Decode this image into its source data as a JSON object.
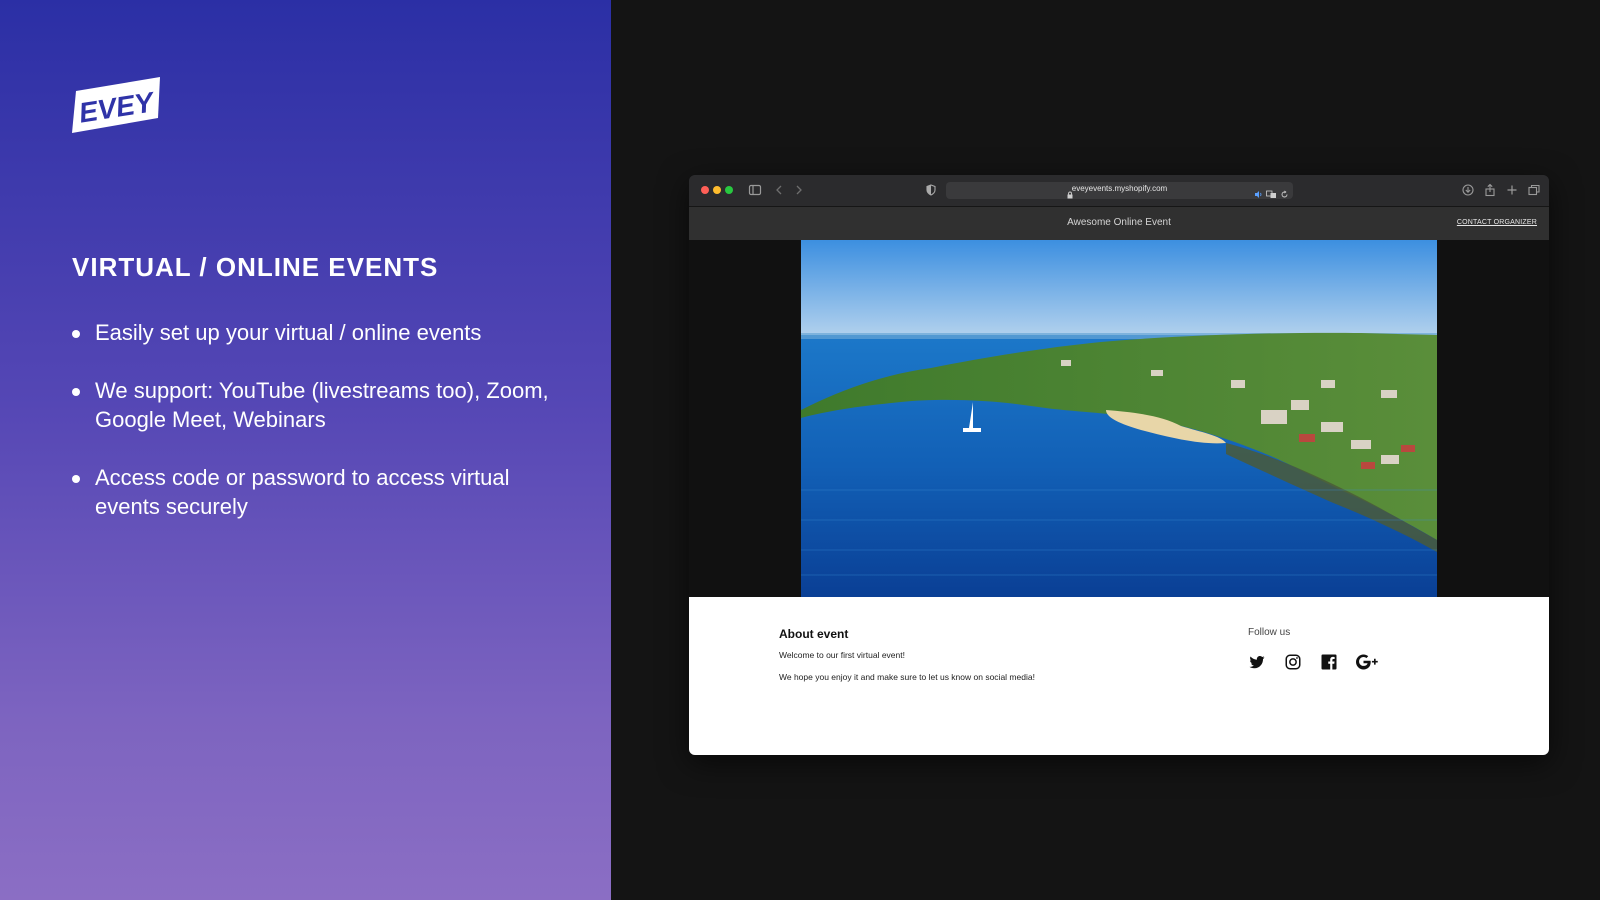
{
  "brand": {
    "logo_text": "EVEY"
  },
  "promo": {
    "title": "VIRTUAL / ONLINE EVENTS",
    "features": [
      "Easily set up your virtual / online events",
      "We support: YouTube (livestreams too), Zoom, Google Meet, Webinars",
      "Access code or password to access virtual events securely"
    ]
  },
  "browser": {
    "url": "eveyevents.myshopify.com",
    "site": {
      "title": "Awesome Online Event",
      "contact_label": "CONTACT ORGANIZER",
      "about": {
        "title": "About event",
        "lines": [
          "Welcome to our first virtual event!",
          "We hope you enjoy it and make sure to let us know on social media!"
        ]
      },
      "follow": {
        "title": "Follow us",
        "icons": [
          "twitter-icon",
          "instagram-icon",
          "facebook-icon",
          "google-plus-icon"
        ]
      }
    }
  },
  "colors": {
    "gradient_top": "#2b2fa5",
    "gradient_bottom": "#8b6ec4",
    "dark_bg": "#141414"
  }
}
